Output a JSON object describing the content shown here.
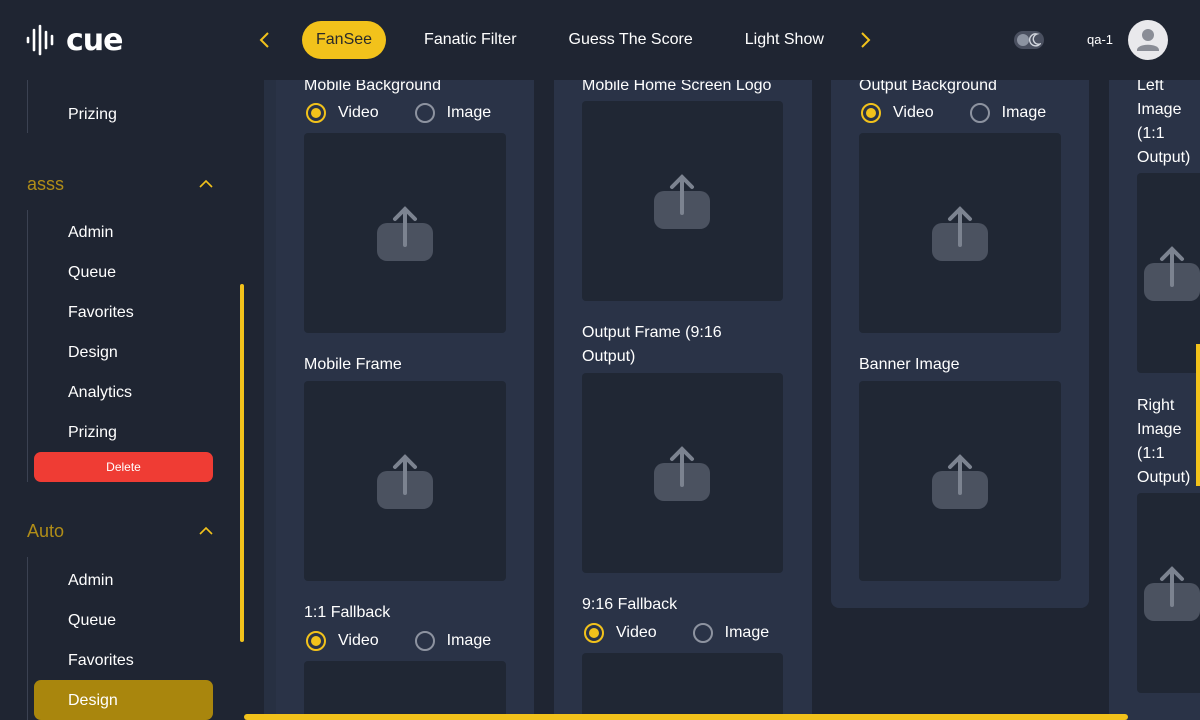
{
  "header": {
    "logo_text": "cue",
    "tabs": [
      {
        "label": "FanSee",
        "active": true
      },
      {
        "label": "Fanatic Filter",
        "active": false
      },
      {
        "label": "Guess The Score",
        "active": false
      },
      {
        "label": "Light Show",
        "active": false
      }
    ],
    "username": "qa-1"
  },
  "sidebar": {
    "items_top": [
      {
        "label": "Prizing"
      }
    ],
    "groups": [
      {
        "name": "asss",
        "items": [
          "Admin",
          "Queue",
          "Favorites",
          "Design",
          "Analytics",
          "Prizing"
        ],
        "delete_label": "Delete"
      },
      {
        "name": "Auto",
        "items": [
          "Admin",
          "Queue",
          "Favorites",
          "Design"
        ]
      }
    ]
  },
  "main": {
    "col1": {
      "mobile_background": "Mobile Background",
      "mobile_frame": "Mobile Frame",
      "fallback_11": "1:1 Fallback",
      "video": "Video",
      "image": "Image"
    },
    "col2": {
      "home_logo": "Mobile Home Screen Logo",
      "output_frame": "Output Frame (9:16 Output)",
      "fallback_916": "9:16 Fallback",
      "video": "Video",
      "image": "Image"
    },
    "col3": {
      "output_background": "Output Background",
      "banner_image": "Banner Image",
      "video": "Video",
      "image": "Image"
    },
    "col4": {
      "left_image": "Left Image (1:1 Output)",
      "right_image": "Right Image (1:1 Output)"
    }
  },
  "colors": {
    "accent": "#f2c21b",
    "danger": "#ef3c34",
    "bg": "#1f2532",
    "panel": "#2a3347"
  }
}
